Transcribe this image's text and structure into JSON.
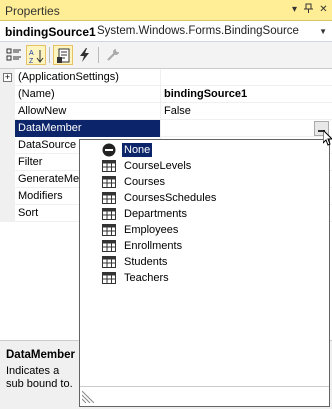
{
  "window": {
    "title": "Properties",
    "title_buttons": [
      "▾",
      "📌",
      "✕"
    ]
  },
  "object_selector": {
    "name": "bindingSource1",
    "type": "System.Windows.Forms.BindingSource"
  },
  "toolbar": {
    "buttons": [
      "categorized-icon",
      "alphabetical-icon",
      "properties-icon",
      "events-icon",
      "property-pages-icon"
    ]
  },
  "grid": {
    "rows": [
      {
        "name": "(ApplicationSettings)",
        "value": "",
        "expandable": true
      },
      {
        "name": "(Name)",
        "value": "bindingSource1",
        "value_bold": true
      },
      {
        "name": "AllowNew",
        "value": "False"
      },
      {
        "name": "DataMember",
        "value": "",
        "selected": true
      },
      {
        "name": "DataSource",
        "value": ""
      },
      {
        "name": "Filter",
        "value": ""
      },
      {
        "name": "GenerateMember",
        "value": ""
      },
      {
        "name": "Modifiers",
        "value": ""
      },
      {
        "name": "Sort",
        "value": ""
      }
    ]
  },
  "dropdown": {
    "items": [
      {
        "label": "None",
        "icon": "none-icon",
        "selected": true
      },
      {
        "label": "CourseLevels",
        "icon": "table-icon"
      },
      {
        "label": "Courses",
        "icon": "table-icon"
      },
      {
        "label": "CoursesSchedules",
        "icon": "table-icon"
      },
      {
        "label": "Departments",
        "icon": "table-icon"
      },
      {
        "label": "Employees",
        "icon": "table-icon"
      },
      {
        "label": "Enrollments",
        "icon": "table-icon"
      },
      {
        "label": "Students",
        "icon": "table-icon"
      },
      {
        "label": "Teachers",
        "icon": "table-icon"
      }
    ]
  },
  "description": {
    "title": "DataMember",
    "text": "Indicates a sub bound to."
  },
  "colors": {
    "title_bg": "#ffee96",
    "selection": "#0c246a"
  }
}
